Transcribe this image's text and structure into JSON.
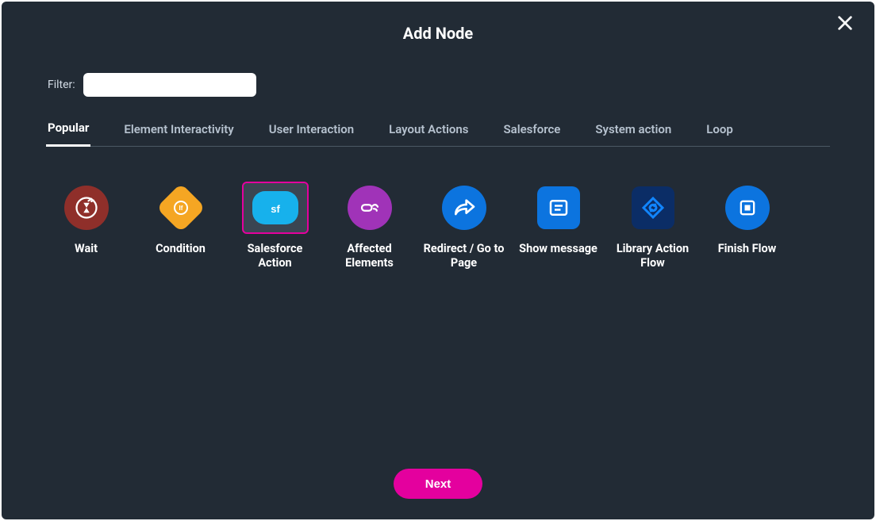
{
  "dialog": {
    "title": "Add Node",
    "close_aria": "Close"
  },
  "filter": {
    "label": "Filter:",
    "value": "",
    "placeholder": ""
  },
  "tabs": [
    {
      "label": "Popular",
      "active": true
    },
    {
      "label": "Element Interactivity",
      "active": false
    },
    {
      "label": "User Interaction",
      "active": false
    },
    {
      "label": "Layout Actions",
      "active": false
    },
    {
      "label": "Salesforce",
      "active": false
    },
    {
      "label": "System action",
      "active": false
    },
    {
      "label": "Loop",
      "active": false
    }
  ],
  "nodes": [
    {
      "id": "wait",
      "label": "Wait",
      "icon": "hourglass-icon",
      "color": "red",
      "selected": false
    },
    {
      "id": "condition",
      "label": "Condition",
      "icon": "diamond-if-icon",
      "color": "orange",
      "selected": false
    },
    {
      "id": "salesforce-action",
      "label": "Salesforce Action",
      "icon": "cloud-sf-icon",
      "color": "sky",
      "selected": true
    },
    {
      "id": "affected-elements",
      "label": "Affected Elements",
      "icon": "hand-tap-icon",
      "color": "purple",
      "selected": false
    },
    {
      "id": "redirect",
      "label": "Redirect / Go to Page",
      "icon": "share-arrow-icon",
      "color": "blue",
      "selected": false
    },
    {
      "id": "show-message",
      "label": "Show message",
      "icon": "message-lines-icon",
      "color": "bluesq",
      "selected": false
    },
    {
      "id": "library-action-flow",
      "label": "Library Action Flow",
      "icon": "refresh-diamond-icon",
      "color": "navy",
      "selected": false
    },
    {
      "id": "finish-flow",
      "label": "Finish Flow",
      "icon": "stop-square-icon",
      "color": "blue",
      "selected": false
    }
  ],
  "footer": {
    "next_label": "Next"
  },
  "colors": {
    "accent": "#e4009e",
    "bg": "#222b35"
  }
}
